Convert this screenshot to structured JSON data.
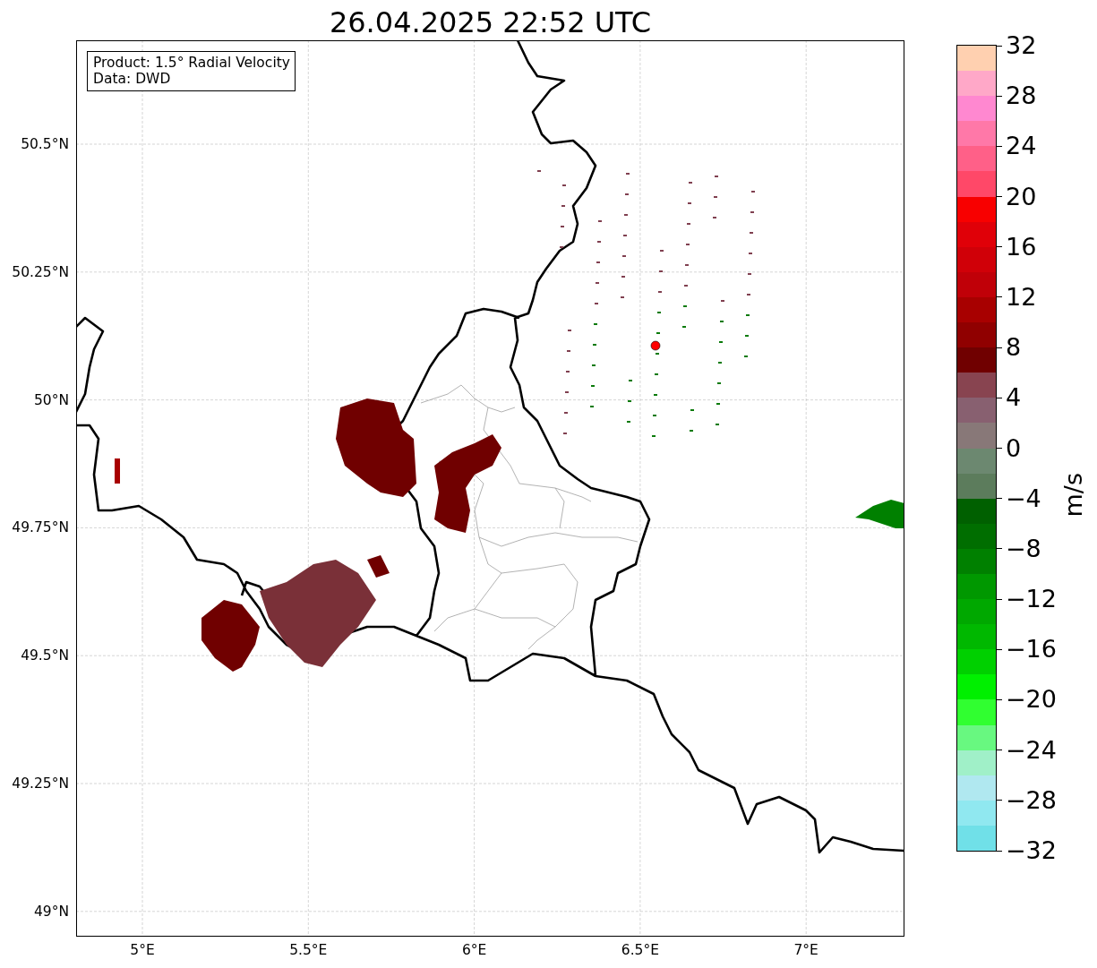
{
  "title": "26.04.2025 22:52 UTC",
  "info_box": {
    "lines": [
      "Product: 1.5° Radial Velocity",
      "Data: DWD"
    ]
  },
  "map": {
    "y_ticks": [
      "50.5°N",
      "50.25°N",
      "50°N",
      "49.75°N",
      "49.5°N",
      "49.25°N",
      "49°N"
    ],
    "x_ticks": [
      "5°E",
      "5.5°E",
      "6°E",
      "6.5°E",
      "7°E"
    ]
  },
  "colorbar": {
    "label": "m/s",
    "ticks": [
      "32",
      "28",
      "24",
      "20",
      "16",
      "12",
      "8",
      "4",
      "0",
      "−4",
      "−8",
      "−12",
      "−16",
      "−20",
      "−24",
      "−28",
      "−32"
    ],
    "bands": [
      {
        "color": "#ffd0b0"
      },
      {
        "color": "#ffa8c8"
      },
      {
        "color": "#ff88d0"
      },
      {
        "color": "#ff78a8"
      },
      {
        "color": "#ff6088"
      },
      {
        "color": "#ff4868"
      },
      {
        "color": "#f80000"
      },
      {
        "color": "#e00008"
      },
      {
        "color": "#d00008"
      },
      {
        "color": "#c00008"
      },
      {
        "color": "#a80000"
      },
      {
        "color": "#900000"
      },
      {
        "color": "#700000"
      },
      {
        "color": "#884450"
      },
      {
        "color": "#886070"
      },
      {
        "color": "#887878"
      },
      {
        "color": "#6c8870"
      },
      {
        "color": "#5c7c5c"
      },
      {
        "color": "#006000"
      },
      {
        "color": "#006e00"
      },
      {
        "color": "#008000"
      },
      {
        "color": "#009800"
      },
      {
        "color": "#00a800"
      },
      {
        "color": "#00b800"
      },
      {
        "color": "#00d000"
      },
      {
        "color": "#00f000"
      },
      {
        "color": "#30ff30"
      },
      {
        "color": "#68f880"
      },
      {
        "color": "#a0f0c8"
      },
      {
        "color": "#b0e8f0"
      },
      {
        "color": "#90e8f0"
      },
      {
        "color": "#70e0e8"
      }
    ]
  }
}
